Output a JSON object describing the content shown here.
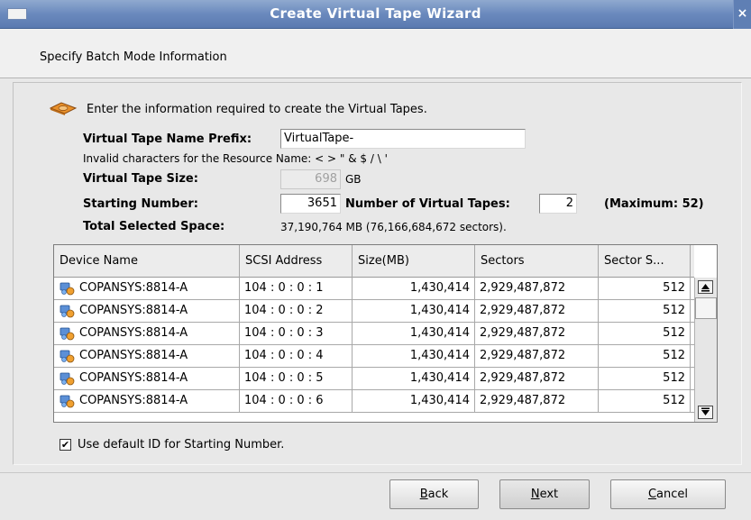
{
  "window": {
    "title": "Create Virtual Tape Wizard",
    "close_glyph": "×"
  },
  "header": {
    "subtitle": "Specify Batch Mode Information"
  },
  "intro": {
    "text": "Enter the information required to create the Virtual Tapes."
  },
  "form": {
    "name_prefix_label": "Virtual Tape Name Prefix:",
    "name_prefix_value": "VirtualTape-",
    "invalid_chars_note": "Invalid characters for the Resource Name: < > \" & $ / \\ '",
    "size_label": "Virtual Tape Size:",
    "size_value": "698",
    "size_unit": "GB",
    "starting_number_label": "Starting Number:",
    "starting_number_value": "3651",
    "num_tapes_label": "Number of Virtual Tapes:",
    "num_tapes_value": "2",
    "max_note": "(Maximum: 52)",
    "total_space_label": "Total Selected Space:",
    "total_space_value": "37,190,764 MB (76,166,684,672 sectors)."
  },
  "table": {
    "columns": [
      "Device Name",
      "SCSI Address",
      "Size(MB)",
      "Sectors",
      "Sector S..."
    ],
    "rows": [
      [
        "COPANSYS:8814-A",
        "104 : 0 : 0 : 1",
        "1,430,414",
        "2,929,487,872",
        "512"
      ],
      [
        "COPANSYS:8814-A",
        "104 : 0 : 0 : 2",
        "1,430,414",
        "2,929,487,872",
        "512"
      ],
      [
        "COPANSYS:8814-A",
        "104 : 0 : 0 : 3",
        "1,430,414",
        "2,929,487,872",
        "512"
      ],
      [
        "COPANSYS:8814-A",
        "104 : 0 : 0 : 4",
        "1,430,414",
        "2,929,487,872",
        "512"
      ],
      [
        "COPANSYS:8814-A",
        "104 : 0 : 0 : 5",
        "1,430,414",
        "2,929,487,872",
        "512"
      ],
      [
        "COPANSYS:8814-A",
        "104 : 0 : 0 : 6",
        "1,430,414",
        "2,929,487,872",
        "512"
      ]
    ]
  },
  "checkbox": {
    "label": "Use default ID for Starting Number.",
    "checked_glyph": "✔"
  },
  "buttons": {
    "back": {
      "mnemonic": "B",
      "rest": "ack"
    },
    "next": {
      "mnemonic": "N",
      "rest": "ext"
    },
    "cancel": {
      "mnemonic": "C",
      "rest": "ancel"
    }
  },
  "colors": {
    "titlebar": "#6a89bd",
    "background": "#e8e8e8"
  }
}
